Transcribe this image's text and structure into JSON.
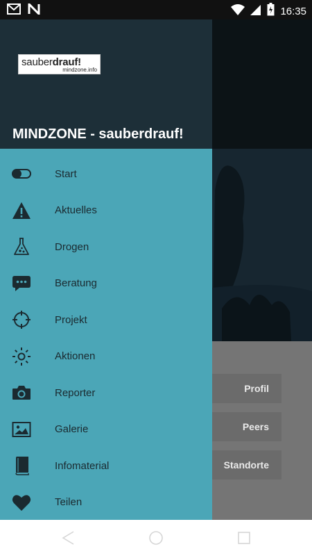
{
  "status_bar": {
    "time": "16:35",
    "left_icons": [
      "gmail-icon",
      "n-app-icon"
    ],
    "right_icons": [
      "wifi-icon",
      "signal-icon",
      "battery-charging-icon"
    ]
  },
  "drawer": {
    "logo": {
      "main_light": "sauber",
      "main_bold": "drauf!",
      "sub": "mindzone.info"
    },
    "title": "MINDZONE - sauberdrauf!",
    "items": [
      {
        "label": "Start",
        "icon": "pill-icon"
      },
      {
        "label": "Aktuelles",
        "icon": "warning-icon"
      },
      {
        "label": "Drogen",
        "icon": "flask-icon"
      },
      {
        "label": "Beratung",
        "icon": "chat-icon"
      },
      {
        "label": "Projekt",
        "icon": "crosshair-icon"
      },
      {
        "label": "Aktionen",
        "icon": "sun-icon"
      },
      {
        "label": "Reporter",
        "icon": "camera-icon"
      },
      {
        "label": "Galerie",
        "icon": "image-icon"
      },
      {
        "label": "Infomaterial",
        "icon": "book-icon"
      },
      {
        "label": "Teilen",
        "icon": "heart-icon"
      }
    ],
    "colors": {
      "header": "#1d2f38",
      "background": "#4ba6b7",
      "text": "#1b2a30"
    }
  },
  "background_app": {
    "buttons": [
      "Profil",
      "Peers",
      "Standorte"
    ]
  },
  "nav_bar": {
    "icons": [
      "back-icon",
      "home-icon",
      "recents-icon"
    ]
  }
}
